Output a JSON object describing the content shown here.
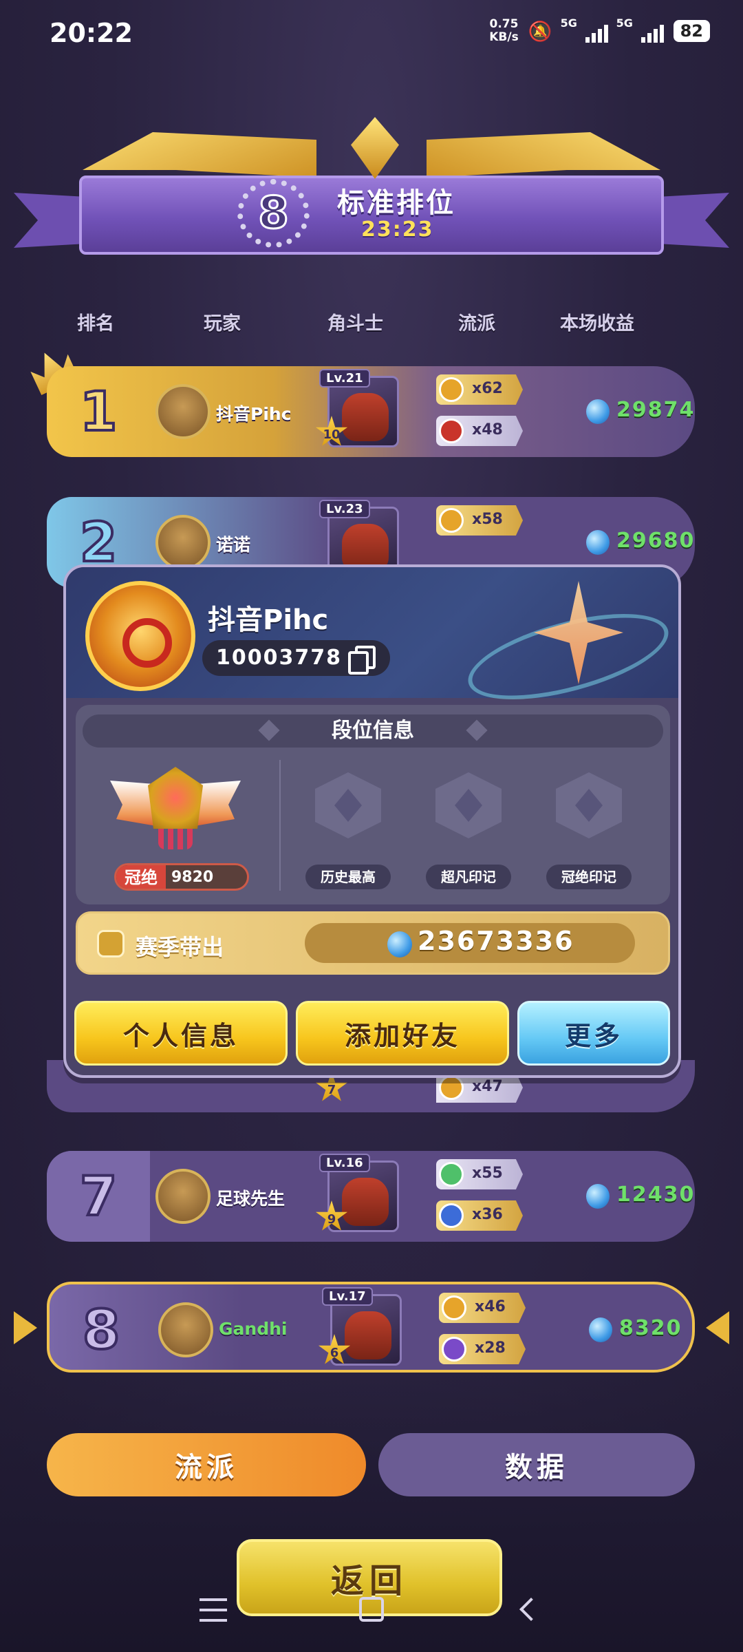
{
  "status_bar": {
    "time": "20:22",
    "net_speed_value": "0.75",
    "net_speed_unit": "KB/s",
    "sim1": "5G",
    "sim2": "5G",
    "battery": "82"
  },
  "header": {
    "rank": "8",
    "title": "标准排位",
    "timer": "23:23"
  },
  "columns": [
    "排名",
    "玩家",
    "角斗士",
    "流派",
    "本场收益"
  ],
  "rows": [
    {
      "rank": "1",
      "player": "抖音Pihc",
      "hero_level": "Lv.21",
      "hero_stars": "10",
      "traits": [
        {
          "count": "x62"
        },
        {
          "count": "x48"
        }
      ],
      "earnings": "29874"
    },
    {
      "rank": "2",
      "player": "诺诺",
      "hero_level": "Lv.23",
      "traits": [
        {
          "count": "x58"
        }
      ],
      "earnings": "29680"
    },
    {
      "rank": "7",
      "player": "足球先生",
      "hero_level": "Lv.16",
      "hero_stars": "9",
      "traits": [
        {
          "count": "x55"
        },
        {
          "count": "x36"
        }
      ],
      "earnings": "12430"
    },
    {
      "rank": "8",
      "player": "Gandhi",
      "hero_level": "Lv.17",
      "hero_stars": "6",
      "traits": [
        {
          "count": "x46"
        },
        {
          "count": "x28"
        }
      ],
      "earnings": "8320"
    }
  ],
  "peek_row": {
    "hero_stars": "7",
    "trait_count": "x47"
  },
  "popup": {
    "name": "抖音Pihc",
    "id": "10003778",
    "rank_panel_title": "段位信息",
    "current_tier": "冠绝",
    "current_points": "9820",
    "slots": [
      "历史最高",
      "超凡印记",
      "冠绝印记"
    ],
    "season_label": "赛季带出",
    "season_value": "23673336",
    "buttons": [
      "个人信息",
      "添加好友",
      "更多"
    ]
  },
  "tabs": [
    "流派",
    "数据"
  ],
  "back_button": "返回",
  "colors": {
    "background": "#2a2340",
    "row": "#5b4a83",
    "gold": "#f0c24c",
    "earnings_green": "#6fe06a",
    "button_yellow": "#f7c51c",
    "button_blue": "#64c8f5"
  }
}
